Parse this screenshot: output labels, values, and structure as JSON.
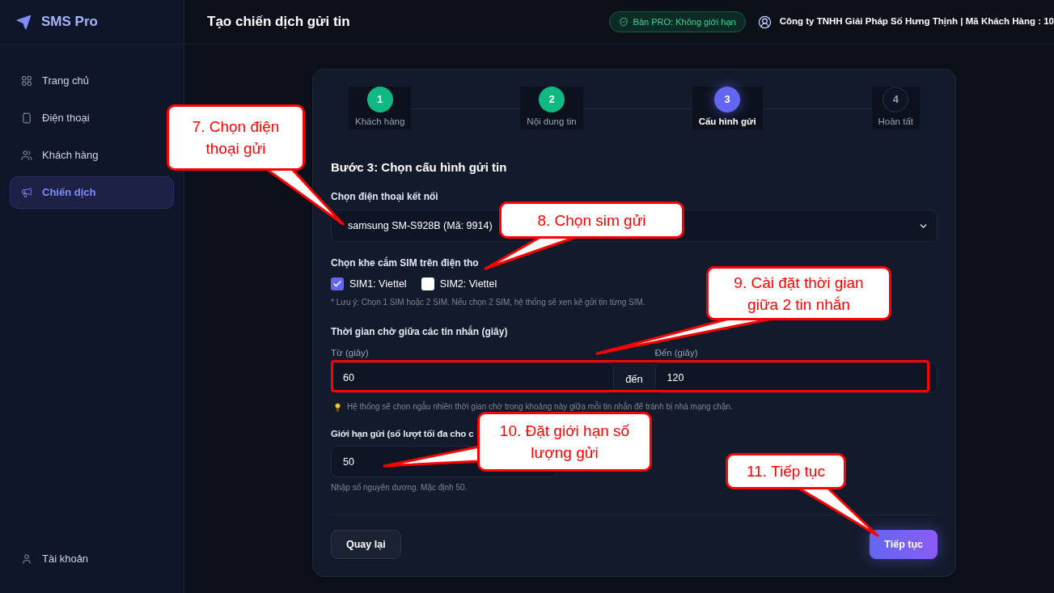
{
  "sidebar": {
    "brand": "SMS Pro",
    "items": [
      {
        "label": "Trang chủ",
        "selected": false
      },
      {
        "label": "Điện thoại",
        "selected": false
      },
      {
        "label": "Khách hàng",
        "selected": false
      },
      {
        "label": "Chiến dịch",
        "selected": true
      }
    ],
    "account_item": {
      "label": "Tài khoản"
    }
  },
  "header": {
    "title": "Tạo chiến dịch gửi tin",
    "plan_badge": "Bản PRO: Không giới hạn",
    "account": "Công ty TNHH Giải Pháp Số Hưng Thịnh | Mã Khách Hàng : 10"
  },
  "stepper": [
    {
      "number": "1",
      "label": "Khách hàng",
      "completed": true,
      "selected": false
    },
    {
      "number": "2",
      "label": "Nội dung tin",
      "completed": true,
      "selected": false
    },
    {
      "number": "3",
      "label": "Cấu hình gửi",
      "completed": false,
      "selected": true
    },
    {
      "number": "4",
      "label": "Hoàn tất",
      "completed": false,
      "selected": false
    }
  ],
  "form": {
    "heading": "Bước 3: Chọn cấu hình gửi tin",
    "phone": {
      "label": "Chọn điện thoại kết nối",
      "value": "samsung SM-S928B (Mã: 9914)"
    },
    "sim": {
      "label": "Chọn khe cắm SIM trên điện tho",
      "options": [
        {
          "label": "SIM1: Viettel",
          "checked": true
        },
        {
          "label": "SIM2: Viettel",
          "checked": false
        }
      ],
      "note": "* Lưu ý: Chọn 1 SIM hoặc 2 SIM. Nếu chọn 2 SIM, hệ thống sẽ xen kẽ gửi tin từng SIM."
    },
    "delay": {
      "label": "Thời gian chờ giữa các tin nhắn (giây)",
      "from": {
        "label": "Từ (giây)",
        "value": "60"
      },
      "separator": "đến",
      "to": {
        "label": "Đến (giây)",
        "value": "120"
      },
      "highlighted": true,
      "hint": "Hệ thống sẽ chọn ngẫu nhiên thời gian chờ trong khoảng này giữa mỗi tin nhắn để tránh bị nhà mạng chặn."
    },
    "limit": {
      "label": "Giới hạn gửi (số lượt tối đa cho c",
      "value": "50",
      "hint": "Nhập số nguyên dương. Mặc định 50."
    },
    "buttons": [
      {
        "label": "Quay lại",
        "kind": "secondary"
      },
      {
        "label": "Tiếp tục",
        "kind": "primary"
      }
    ]
  },
  "annotations": [
    {
      "text": "7. Chọn điện thoại gửi"
    },
    {
      "text": "8. Chọn sim gửi"
    },
    {
      "text": "9. Cài đặt thời gian giữa 2 tin nhắn"
    },
    {
      "text": "10. Đặt giới hạn số lượng gửi"
    },
    {
      "text": "11. Tiếp tục"
    }
  ]
}
